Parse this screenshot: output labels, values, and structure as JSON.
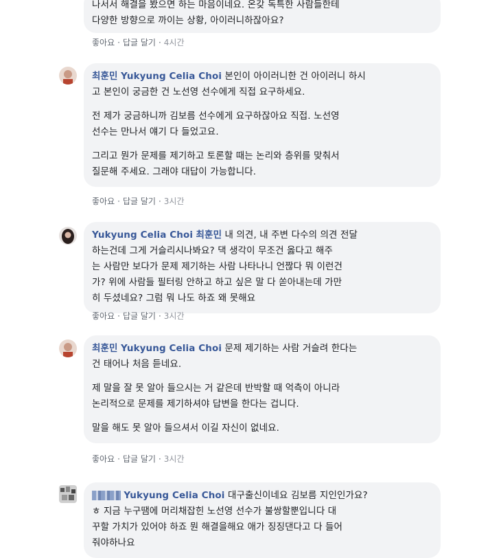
{
  "comments": [
    {
      "lines": [
        "나서서 해결을 봤으면 하는 마음이네요. 온갖 독특한 사람들한테",
        "다양한 방향으로 까이는 상황, 아이러니하잖아요?"
      ],
      "like": "좋아요",
      "reply": "답글 달기",
      "time": "4시간"
    },
    {
      "author": "최훈민",
      "mention": "Yukyung Celia Choi",
      "p1_first": "본인이 아이러니한 건 아이러니 하시",
      "p1_rest": "고 본인이 궁금한 건 노선영 선수에게 직접 요구하세요.",
      "p2a": "전 제가 궁금하니까 김보름 선수에게 요구하잖아요 직접. 노선영",
      "p2b": "선수는 만나서 얘기 다 들었고요.",
      "p3a": "그리고 뭔가 문제를 제기하고 토론할 때는 논리와 층위를 맞춰서",
      "p3b": "질문해 주세요. 그래야 대답이 가능합니다.",
      "like": "좋아요",
      "reply": "답글 달기",
      "time": "3시간"
    },
    {
      "author": "Yukyung Celia Choi",
      "mention": "최훈민",
      "first": "내 의견, 내 주변 다수의 의견 전달",
      "l2": "하는건데 그게 거슬리시나봐요? 댁 생각이 무조건 옳다고 해주",
      "l3": "는 사람만 보다가 문제 제기하는 사람 나타나니 언짢다 뭐 이런건",
      "l4": "가? 위에 사람들 필터링 안하고 하고 싶은 말 다 쏟아내는데 가만",
      "l5": "히 두셨네요? 그럼 뭐 나도 하죠 왜 못해요",
      "like": "좋아요",
      "reply": "답글 달기",
      "time": "3시간"
    },
    {
      "author": "최훈민",
      "mention": "Yukyung Celia Choi",
      "first": "문제 제기하는 사람 거슬려 한다는",
      "l2": "건 태어나 처음 듣네요.",
      "p2a": "제 말을 잘 못 알아 들으시는 거 같은데 반박할 때 억측이 아니라",
      "p2b": "논리적으로 문제를 제기하셔야 답변을 한다는 겁니다.",
      "p3": "말을 해도 못 알아 들으셔서 이길 자신이 없네요.",
      "like": "좋아요",
      "reply": "답글 달기",
      "time": "3시간"
    },
    {
      "author": "",
      "mention": "Yukyung Celia Choi",
      "first": "대구출신이네요 김보름 지인인가요?",
      "l2": "ㅎ 지금 누구땜에 머리채잡힌 노선영 선수가 불쌍할뿐입니다 대",
      "l3": "꾸할 가치가 있어야 하죠 뭔 해결을해요 애가 징징댄다고 다 들어",
      "l4": "줘야하나요"
    }
  ]
}
